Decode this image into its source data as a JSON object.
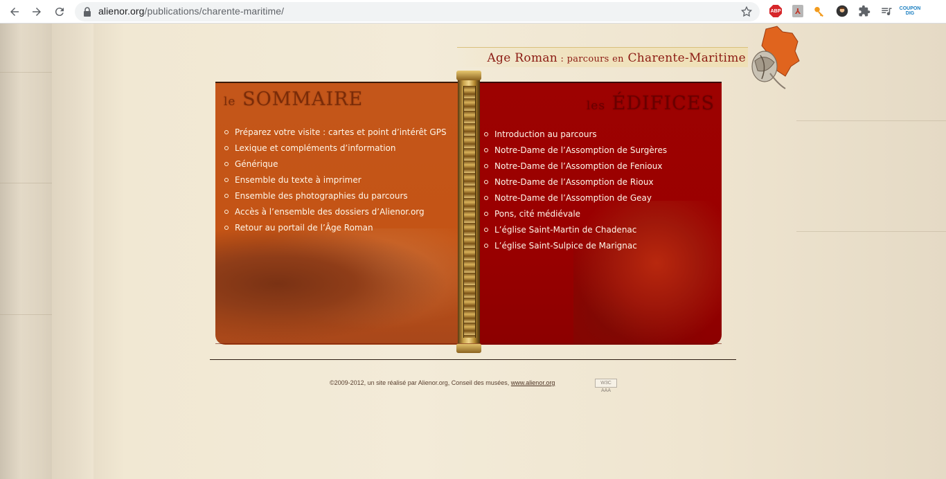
{
  "browser": {
    "url_domain": "alienor.org",
    "url_path": "/publications/charente-maritime/",
    "extensions": [
      {
        "name": "adblock-plus-icon",
        "label": "ABP"
      },
      {
        "name": "acrobat-icon"
      },
      {
        "name": "key-icon"
      },
      {
        "name": "profile-icon"
      },
      {
        "name": "puzzle-extensions-icon"
      },
      {
        "name": "media-queue-icon"
      },
      {
        "name": "coupon-icon",
        "label": "COUPON DIG"
      }
    ]
  },
  "header": {
    "title_part1": "Age Roman",
    "title_sep": " : ",
    "title_part2": "parcours en",
    "title_part3": "Charente-Maritime"
  },
  "sommaire": {
    "heading_small": "le",
    "heading_big": "SOMMAIRE",
    "items": [
      "Préparez votre visite : cartes et point d’intérêt GPS",
      "Lexique et compléments d’information",
      "Générique",
      "Ensemble du texte à imprimer",
      "Ensemble des photographies du parcours",
      "Accès à l’ensemble des dossiers d’Alienor.org",
      "Retour au portail de l’Âge Roman"
    ]
  },
  "edifices": {
    "heading_small": "les",
    "heading_big": "ÉDIFICES",
    "items": [
      "Introduction au parcours",
      "Notre-Dame de l’Assomption de Surgères",
      "Notre-Dame de l’Assomption de Fenioux",
      "Notre-Dame de l’Assomption de Rioux",
      "Notre-Dame de l’Assomption de Geay",
      "Pons, cité médiévale",
      "L’église Saint-Martin de Chadenac",
      "L’église Saint-Sulpice de Marignac"
    ]
  },
  "footer": {
    "text": "©2009-2012, un site réalisé par Alienor.org, Conseil des musées, ",
    "link": "www.alienor.org",
    "badge": "W3C AAA"
  },
  "colors": {
    "sommaire_bg": "#c4561a",
    "edifices_bg": "#9d0201",
    "title_red": "#8b1a12"
  }
}
